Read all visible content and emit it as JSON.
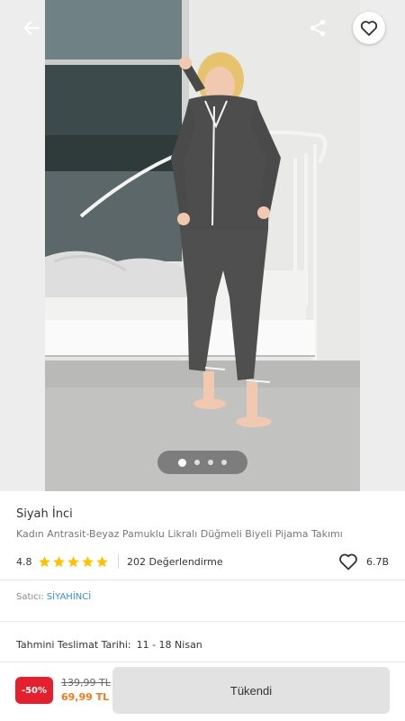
{
  "header": {
    "back_icon": "arrow-left-icon",
    "share_icon": "share-icon",
    "favorite_icon": "heart-outline-icon"
  },
  "gallery": {
    "image_count": 4,
    "active_index": 0
  },
  "product": {
    "brand": "Siyah İnci",
    "name": "Kadın Antrasit-Beyaz Pamuklu Likralı Düğmeli Biyeli Pijama Takımı",
    "rating": "4.8",
    "stars_filled": 5,
    "review_count": "202 Değerlendirme",
    "favorite_count": "6.7B"
  },
  "seller": {
    "label": "Satıcı:",
    "name": "SİYAHİNCİ"
  },
  "delivery": {
    "label": "Tahmini Teslimat Tarihi:",
    "value": "11 - 18 Nisan"
  },
  "purchase": {
    "discount": "-50%",
    "old_price": "139,99 TL",
    "new_price": "69,99 TL",
    "button_label": "Tükendi"
  },
  "colors": {
    "accent_orange": "#f27a1a",
    "discount_red": "#e5202e",
    "star_yellow": "#ffc000",
    "link_blue": "#3a8ed3"
  }
}
